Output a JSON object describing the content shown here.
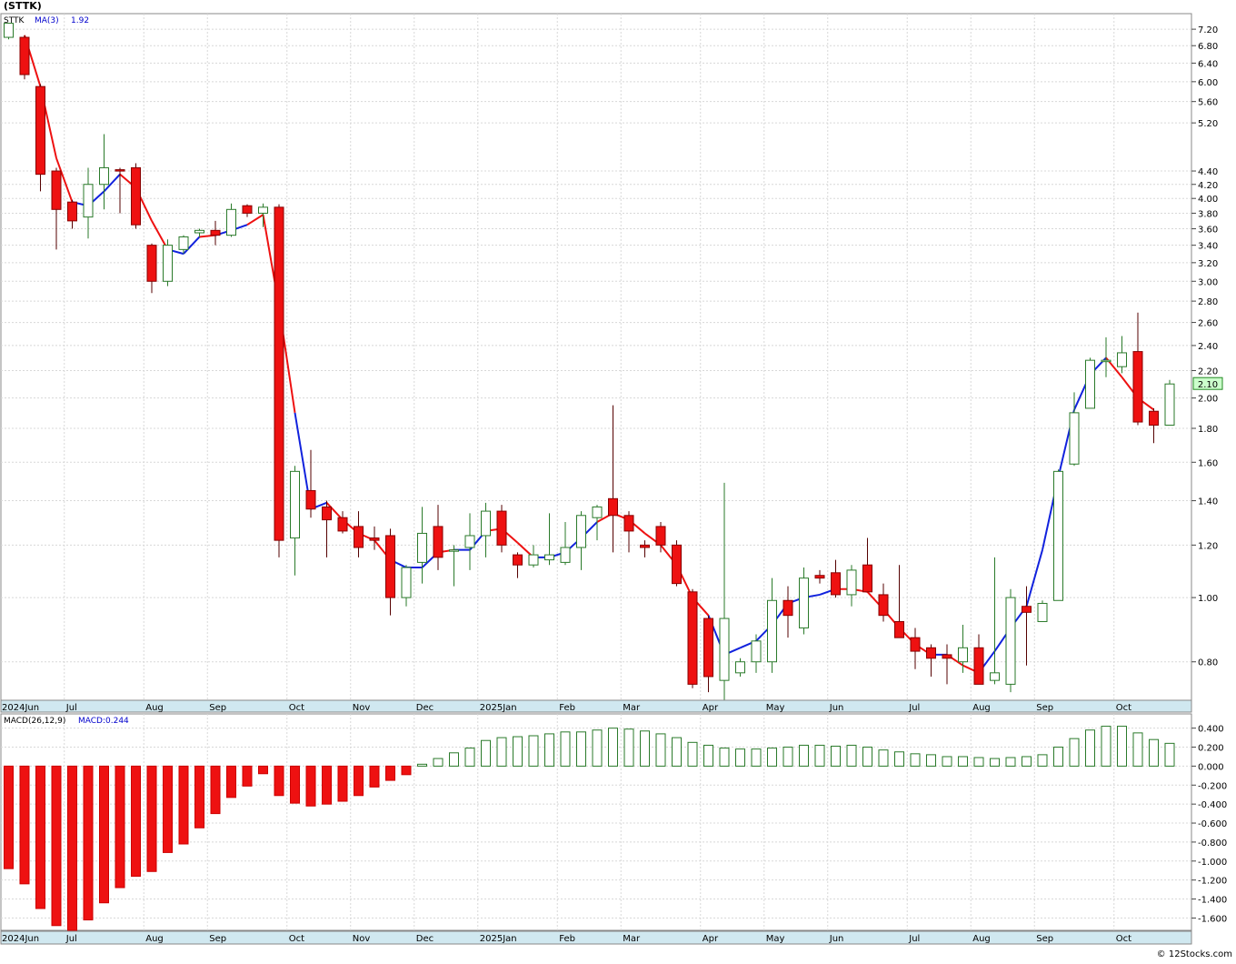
{
  "header": {
    "title": "(STTK)"
  },
  "footer": {
    "credit": "© 12Stocks.com"
  },
  "chart_data": [
    {
      "type": "candlestick",
      "symbol_label": "STTK",
      "indicator_label": "MA(3)",
      "indicator_value": "1.92",
      "last_price_label": "2.10",
      "scale": "log",
      "ylim": [
        0.7,
        7.6
      ],
      "y_ticks": [
        0.8,
        1.0,
        1.2,
        1.4,
        1.6,
        1.8,
        2.0,
        2.2,
        2.4,
        2.6,
        2.8,
        3.0,
        3.2,
        3.4,
        3.6,
        3.8,
        4.0,
        4.2,
        4.4,
        5.2,
        5.6,
        6.0,
        6.4,
        6.8,
        7.2
      ],
      "y_tick_labels": [
        "0.80",
        "1.00",
        "1.20",
        "1.40",
        "1.60",
        "1.80",
        "2.00",
        "2.20",
        "2.40",
        "2.60",
        "2.80",
        "3.00",
        "3.20",
        "3.40",
        "3.60",
        "3.80",
        "4.00",
        "4.20",
        "4.40",
        "5.20",
        "5.60",
        "6.00",
        "6.40",
        "6.80",
        "7.20"
      ],
      "x_labels": [
        {
          "label": "2024Jun",
          "index": -0.5
        },
        {
          "label": "Jul",
          "index": 4
        },
        {
          "label": "Aug",
          "index": 9
        },
        {
          "label": "Sep",
          "index": 13
        },
        {
          "label": "Oct",
          "index": 18
        },
        {
          "label": "Nov",
          "index": 22
        },
        {
          "label": "Dec",
          "index": 26
        },
        {
          "label": "2025Jan",
          "index": 30
        },
        {
          "label": "Feb",
          "index": 35
        },
        {
          "label": "Mar",
          "index": 39
        },
        {
          "label": "Apr",
          "index": 44
        },
        {
          "label": "May",
          "index": 48
        },
        {
          "label": "Jun",
          "index": 52
        },
        {
          "label": "Jul",
          "index": 57
        },
        {
          "label": "Aug",
          "index": 61
        },
        {
          "label": "Sep",
          "index": 65
        },
        {
          "label": "Oct",
          "index": 70
        }
      ],
      "candles": [
        {
          "o": 7.0,
          "h": 7.35,
          "l": 6.95,
          "c": 7.35
        },
        {
          "o": 7.0,
          "h": 7.05,
          "l": 6.05,
          "c": 6.15
        },
        {
          "o": 5.9,
          "h": 5.95,
          "l": 4.1,
          "c": 4.35
        },
        {
          "o": 4.4,
          "h": 4.45,
          "l": 3.35,
          "c": 3.85
        },
        {
          "o": 3.95,
          "h": 3.98,
          "l": 3.6,
          "c": 3.7
        },
        {
          "o": 3.75,
          "h": 4.45,
          "l": 3.48,
          "c": 4.2
        },
        {
          "o": 4.2,
          "h": 5.0,
          "l": 3.85,
          "c": 4.45
        },
        {
          "o": 4.42,
          "h": 4.45,
          "l": 3.8,
          "c": 4.4
        },
        {
          "o": 4.45,
          "h": 4.52,
          "l": 3.6,
          "c": 3.65
        },
        {
          "o": 3.4,
          "h": 3.42,
          "l": 2.88,
          "c": 3.0
        },
        {
          "o": 3.0,
          "h": 3.47,
          "l": 2.95,
          "c": 3.4
        },
        {
          "o": 3.35,
          "h": 3.52,
          "l": 3.3,
          "c": 3.5
        },
        {
          "o": 3.55,
          "h": 3.6,
          "l": 3.5,
          "c": 3.58
        },
        {
          "o": 3.58,
          "h": 3.7,
          "l": 3.4,
          "c": 3.52
        },
        {
          "o": 3.52,
          "h": 3.93,
          "l": 3.5,
          "c": 3.85
        },
        {
          "o": 3.9,
          "h": 3.92,
          "l": 3.75,
          "c": 3.8
        },
        {
          "o": 3.8,
          "h": 3.93,
          "l": 3.62,
          "c": 3.88
        },
        {
          "o": 3.88,
          "h": 3.92,
          "l": 1.15,
          "c": 1.22
        },
        {
          "o": 1.23,
          "h": 1.58,
          "l": 1.08,
          "c": 1.55
        },
        {
          "o": 1.45,
          "h": 1.67,
          "l": 1.32,
          "c": 1.36
        },
        {
          "o": 1.37,
          "h": 1.4,
          "l": 1.15,
          "c": 1.31
        },
        {
          "o": 1.32,
          "h": 1.35,
          "l": 1.25,
          "c": 1.26
        },
        {
          "o": 1.28,
          "h": 1.35,
          "l": 1.15,
          "c": 1.19
        },
        {
          "o": 1.23,
          "h": 1.28,
          "l": 1.18,
          "c": 1.22
        },
        {
          "o": 1.24,
          "h": 1.27,
          "l": 0.94,
          "c": 1.0
        },
        {
          "o": 1.0,
          "h": 1.12,
          "l": 0.97,
          "c": 1.11
        },
        {
          "o": 1.13,
          "h": 1.37,
          "l": 1.05,
          "c": 1.25
        },
        {
          "o": 1.28,
          "h": 1.38,
          "l": 1.1,
          "c": 1.15
        },
        {
          "o": 1.18,
          "h": 1.2,
          "l": 1.04,
          "c": 1.18
        },
        {
          "o": 1.19,
          "h": 1.34,
          "l": 1.1,
          "c": 1.24
        },
        {
          "o": 1.24,
          "h": 1.39,
          "l": 1.15,
          "c": 1.35
        },
        {
          "o": 1.35,
          "h": 1.38,
          "l": 1.17,
          "c": 1.2
        },
        {
          "o": 1.16,
          "h": 1.17,
          "l": 1.07,
          "c": 1.12
        },
        {
          "o": 1.12,
          "h": 1.2,
          "l": 1.11,
          "c": 1.16
        },
        {
          "o": 1.14,
          "h": 1.34,
          "l": 1.12,
          "c": 1.16
        },
        {
          "o": 1.13,
          "h": 1.3,
          "l": 1.12,
          "c": 1.19
        },
        {
          "o": 1.19,
          "h": 1.35,
          "l": 1.1,
          "c": 1.33
        },
        {
          "o": 1.32,
          "h": 1.38,
          "l": 1.22,
          "c": 1.37
        },
        {
          "o": 1.41,
          "h": 1.95,
          "l": 1.17,
          "c": 1.33
        },
        {
          "o": 1.33,
          "h": 1.35,
          "l": 1.17,
          "c": 1.26
        },
        {
          "o": 1.2,
          "h": 1.22,
          "l": 1.15,
          "c": 1.19
        },
        {
          "o": 1.28,
          "h": 1.3,
          "l": 1.17,
          "c": 1.2
        },
        {
          "o": 1.2,
          "h": 1.22,
          "l": 1.04,
          "c": 1.05
        },
        {
          "o": 1.02,
          "h": 1.03,
          "l": 0.73,
          "c": 0.74
        },
        {
          "o": 0.93,
          "h": 0.94,
          "l": 0.72,
          "c": 0.76
        },
        {
          "o": 0.75,
          "h": 1.49,
          "l": 0.7,
          "c": 0.93
        },
        {
          "o": 0.77,
          "h": 0.81,
          "l": 0.76,
          "c": 0.8
        },
        {
          "o": 0.8,
          "h": 0.88,
          "l": 0.77,
          "c": 0.86
        },
        {
          "o": 0.8,
          "h": 1.07,
          "l": 0.77,
          "c": 0.99
        },
        {
          "o": 0.99,
          "h": 1.04,
          "l": 0.87,
          "c": 0.94
        },
        {
          "o": 0.9,
          "h": 1.11,
          "l": 0.88,
          "c": 1.07
        },
        {
          "o": 1.08,
          "h": 1.1,
          "l": 1.05,
          "c": 1.07
        },
        {
          "o": 1.09,
          "h": 1.14,
          "l": 1.0,
          "c": 1.01
        },
        {
          "o": 1.01,
          "h": 1.12,
          "l": 0.97,
          "c": 1.1
        },
        {
          "o": 1.12,
          "h": 1.23,
          "l": 1.02,
          "c": 1.02
        },
        {
          "o": 1.01,
          "h": 1.05,
          "l": 0.92,
          "c": 0.94
        },
        {
          "o": 0.92,
          "h": 1.12,
          "l": 0.87,
          "c": 0.87
        },
        {
          "o": 0.87,
          "h": 0.9,
          "l": 0.78,
          "c": 0.83
        },
        {
          "o": 0.84,
          "h": 0.85,
          "l": 0.76,
          "c": 0.81
        },
        {
          "o": 0.82,
          "h": 0.85,
          "l": 0.74,
          "c": 0.81
        },
        {
          "o": 0.8,
          "h": 0.91,
          "l": 0.77,
          "c": 0.84
        },
        {
          "o": 0.84,
          "h": 0.88,
          "l": 0.74,
          "c": 0.74
        },
        {
          "o": 0.75,
          "h": 1.15,
          "l": 0.74,
          "c": 0.77
        },
        {
          "o": 0.74,
          "h": 1.03,
          "l": 0.72,
          "c": 1.0
        },
        {
          "o": 0.97,
          "h": 1.04,
          "l": 0.79,
          "c": 0.95
        },
        {
          "o": 0.92,
          "h": 0.99,
          "l": 0.92,
          "c": 0.98
        },
        {
          "o": 0.99,
          "h": 1.56,
          "l": 0.99,
          "c": 1.55
        },
        {
          "o": 1.59,
          "h": 2.04,
          "l": 1.58,
          "c": 1.9
        },
        {
          "o": 1.93,
          "h": 2.3,
          "l": 1.93,
          "c": 2.28
        },
        {
          "o": 2.28,
          "h": 2.47,
          "l": 2.15,
          "c": 2.28
        },
        {
          "o": 2.23,
          "h": 2.48,
          "l": 2.18,
          "c": 2.34
        },
        {
          "o": 2.35,
          "h": 2.69,
          "l": 1.82,
          "c": 1.84
        },
        {
          "o": 1.91,
          "h": 1.93,
          "l": 1.71,
          "c": 1.82
        },
        {
          "o": 1.82,
          "h": 2.13,
          "l": 1.82,
          "c": 2.1
        }
      ],
      "ma": [
        {
          "i": 1,
          "v": 7.05,
          "color": "red"
        },
        {
          "i": 2,
          "v": 5.9,
          "color": "red"
        },
        {
          "i": 3,
          "v": 4.6,
          "color": "red"
        },
        {
          "i": 4,
          "v": 3.95,
          "color": "red"
        },
        {
          "i": 5,
          "v": 3.9,
          "color": "blue"
        },
        {
          "i": 6,
          "v": 4.1,
          "color": "blue"
        },
        {
          "i": 7,
          "v": 4.35,
          "color": "blue"
        },
        {
          "i": 8,
          "v": 4.15,
          "color": "red"
        },
        {
          "i": 9,
          "v": 3.7,
          "color": "red"
        },
        {
          "i": 10,
          "v": 3.35,
          "color": "red"
        },
        {
          "i": 11,
          "v": 3.3,
          "color": "blue"
        },
        {
          "i": 12,
          "v": 3.5,
          "color": "blue"
        },
        {
          "i": 13,
          "v": 3.52,
          "color": "red"
        },
        {
          "i": 14,
          "v": 3.58,
          "color": "blue"
        },
        {
          "i": 15,
          "v": 3.65,
          "color": "blue"
        },
        {
          "i": 16,
          "v": 3.78,
          "color": "red"
        },
        {
          "i": 17,
          "v": 2.75,
          "color": "red"
        },
        {
          "i": 18,
          "v": 1.9,
          "color": "red"
        },
        {
          "i": 19,
          "v": 1.36,
          "color": "blue"
        },
        {
          "i": 20,
          "v": 1.39,
          "color": "blue"
        },
        {
          "i": 21,
          "v": 1.31,
          "color": "red"
        },
        {
          "i": 22,
          "v": 1.25,
          "color": "red"
        },
        {
          "i": 23,
          "v": 1.22,
          "color": "red"
        },
        {
          "i": 24,
          "v": 1.14,
          "color": "red"
        },
        {
          "i": 25,
          "v": 1.11,
          "color": "blue"
        },
        {
          "i": 26,
          "v": 1.11,
          "color": "blue"
        },
        {
          "i": 27,
          "v": 1.17,
          "color": "blue"
        },
        {
          "i": 28,
          "v": 1.18,
          "color": "red"
        },
        {
          "i": 29,
          "v": 1.18,
          "color": "blue"
        },
        {
          "i": 30,
          "v": 1.26,
          "color": "blue"
        },
        {
          "i": 31,
          "v": 1.27,
          "color": "red"
        },
        {
          "i": 32,
          "v": 1.21,
          "color": "red"
        },
        {
          "i": 33,
          "v": 1.15,
          "color": "red"
        },
        {
          "i": 34,
          "v": 1.15,
          "color": "blue"
        },
        {
          "i": 35,
          "v": 1.17,
          "color": "blue"
        },
        {
          "i": 36,
          "v": 1.23,
          "color": "blue"
        },
        {
          "i": 37,
          "v": 1.3,
          "color": "blue"
        },
        {
          "i": 38,
          "v": 1.34,
          "color": "red"
        },
        {
          "i": 39,
          "v": 1.31,
          "color": "red"
        },
        {
          "i": 40,
          "v": 1.25,
          "color": "red"
        },
        {
          "i": 41,
          "v": 1.2,
          "color": "red"
        },
        {
          "i": 42,
          "v": 1.12,
          "color": "red"
        },
        {
          "i": 43,
          "v": 1.0,
          "color": "red"
        },
        {
          "i": 44,
          "v": 0.94,
          "color": "red"
        },
        {
          "i": 45,
          "v": 0.82,
          "color": "blue"
        },
        {
          "i": 46,
          "v": 0.84,
          "color": "blue"
        },
        {
          "i": 47,
          "v": 0.86,
          "color": "blue"
        },
        {
          "i": 48,
          "v": 0.91,
          "color": "blue"
        },
        {
          "i": 49,
          "v": 0.98,
          "color": "blue"
        },
        {
          "i": 50,
          "v": 1.0,
          "color": "blue"
        },
        {
          "i": 51,
          "v": 1.01,
          "color": "blue"
        },
        {
          "i": 52,
          "v": 1.03,
          "color": "blue"
        },
        {
          "i": 53,
          "v": 1.03,
          "color": "red"
        },
        {
          "i": 54,
          "v": 1.02,
          "color": "red"
        },
        {
          "i": 55,
          "v": 0.96,
          "color": "red"
        },
        {
          "i": 56,
          "v": 0.9,
          "color": "red"
        },
        {
          "i": 57,
          "v": 0.85,
          "color": "red"
        },
        {
          "i": 58,
          "v": 0.82,
          "color": "red"
        },
        {
          "i": 59,
          "v": 0.82,
          "color": "blue"
        },
        {
          "i": 60,
          "v": 0.79,
          "color": "red"
        },
        {
          "i": 61,
          "v": 0.77,
          "color": "red"
        },
        {
          "i": 62,
          "v": 0.83,
          "color": "blue"
        },
        {
          "i": 63,
          "v": 0.9,
          "color": "blue"
        },
        {
          "i": 64,
          "v": 0.97,
          "color": "blue"
        },
        {
          "i": 65,
          "v": 1.18,
          "color": "blue"
        },
        {
          "i": 66,
          "v": 1.52,
          "color": "blue"
        },
        {
          "i": 67,
          "v": 1.92,
          "color": "blue"
        },
        {
          "i": 68,
          "v": 2.17,
          "color": "blue"
        },
        {
          "i": 69,
          "v": 2.3,
          "color": "blue"
        },
        {
          "i": 70,
          "v": 2.15,
          "color": "red"
        },
        {
          "i": 71,
          "v": 2.0,
          "color": "red"
        },
        {
          "i": 72,
          "v": 1.92,
          "color": "red"
        }
      ]
    },
    {
      "type": "bar",
      "label": "MACD(26,12,9)",
      "value_label": "MACD:0.244",
      "ylim": [
        -1.73,
        0.55
      ],
      "y_ticks": [
        -1.6,
        -1.4,
        -1.2,
        -1.0,
        -0.8,
        -0.6,
        -0.4,
        -0.2,
        0.0,
        0.2,
        0.4
      ],
      "y_tick_labels": [
        "-1.600",
        "-1.400",
        "-1.200",
        "-1.000",
        "-0.800",
        "-0.600",
        "-0.400",
        "-0.200",
        "0.000",
        "0.200",
        "0.400"
      ],
      "values": [
        -1.08,
        -1.24,
        -1.5,
        -1.68,
        -1.73,
        -1.62,
        -1.44,
        -1.28,
        -1.16,
        -1.11,
        -0.91,
        -0.82,
        -0.65,
        -0.5,
        -0.33,
        -0.21,
        -0.08,
        -0.31,
        -0.39,
        -0.42,
        -0.4,
        -0.37,
        -0.31,
        -0.22,
        -0.15,
        -0.09,
        0.02,
        0.08,
        0.14,
        0.19,
        0.27,
        0.3,
        0.31,
        0.32,
        0.34,
        0.36,
        0.36,
        0.38,
        0.4,
        0.39,
        0.37,
        0.34,
        0.3,
        0.25,
        0.22,
        0.19,
        0.18,
        0.18,
        0.19,
        0.2,
        0.22,
        0.22,
        0.21,
        0.22,
        0.2,
        0.17,
        0.15,
        0.13,
        0.12,
        0.1,
        0.1,
        0.09,
        0.08,
        0.09,
        0.1,
        0.12,
        0.2,
        0.29,
        0.38,
        0.42,
        0.42,
        0.35,
        0.28,
        0.24
      ]
    }
  ]
}
